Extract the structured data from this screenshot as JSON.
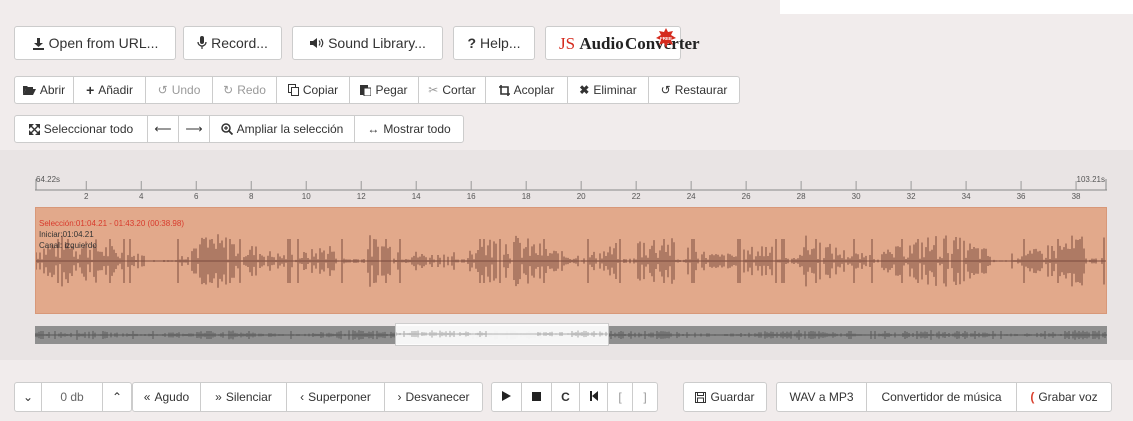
{
  "toolbar_main": {
    "open_url": "Open from URL...",
    "record": "Record...",
    "sound_library": "Sound Library...",
    "help": "Help...",
    "logo": {
      "js": "JS",
      "audio": "Audio",
      "converter": "Converter",
      "badge": "FREE"
    }
  },
  "toolbar_edit": {
    "abrir": "Abrir",
    "anadir": "Añadir",
    "undo": "Undo",
    "redo": "Redo",
    "copiar": "Copiar",
    "pegar": "Pegar",
    "cortar": "Cortar",
    "acoplar": "Acoplar",
    "eliminar": "Eliminar",
    "restaurar": "Restaurar"
  },
  "toolbar_select": {
    "seleccionar_todo": "Seleccionar todo",
    "ampliar": "Ampliar la selección",
    "mostrar_todo": "Mostrar todo"
  },
  "timeline": {
    "start_label": "64.22s",
    "end_label": "103.21s",
    "ticks": [
      "2",
      "4",
      "6",
      "8",
      "10",
      "12",
      "14",
      "16",
      "18",
      "20",
      "22",
      "24",
      "26",
      "28",
      "30",
      "32",
      "34",
      "36",
      "38"
    ]
  },
  "selection": {
    "range": "Selección:01:04.21 - 01:43.20 (00:38.98)",
    "start": "Iniciar:01:04.21",
    "channel": "Canal: izquierdo"
  },
  "bottom": {
    "volume": "0 db",
    "agudo": "Agudo",
    "silenciar": "Silenciar",
    "superponer": "Superponer",
    "desvanecer": "Desvanecer",
    "bracket_left": "[",
    "bracket_right": "]",
    "guardar": "Guardar",
    "wav_mp3": "WAV a MP3",
    "convertidor": "Convertidor de música",
    "grabar": "Grabar voz"
  },
  "colors": {
    "selection_fill": "#e2a98b",
    "waveform": "#7a4a3e",
    "overview": "#8f8f8f",
    "selection_text": "#d83a2c",
    "record_icon": "#d9412f"
  }
}
